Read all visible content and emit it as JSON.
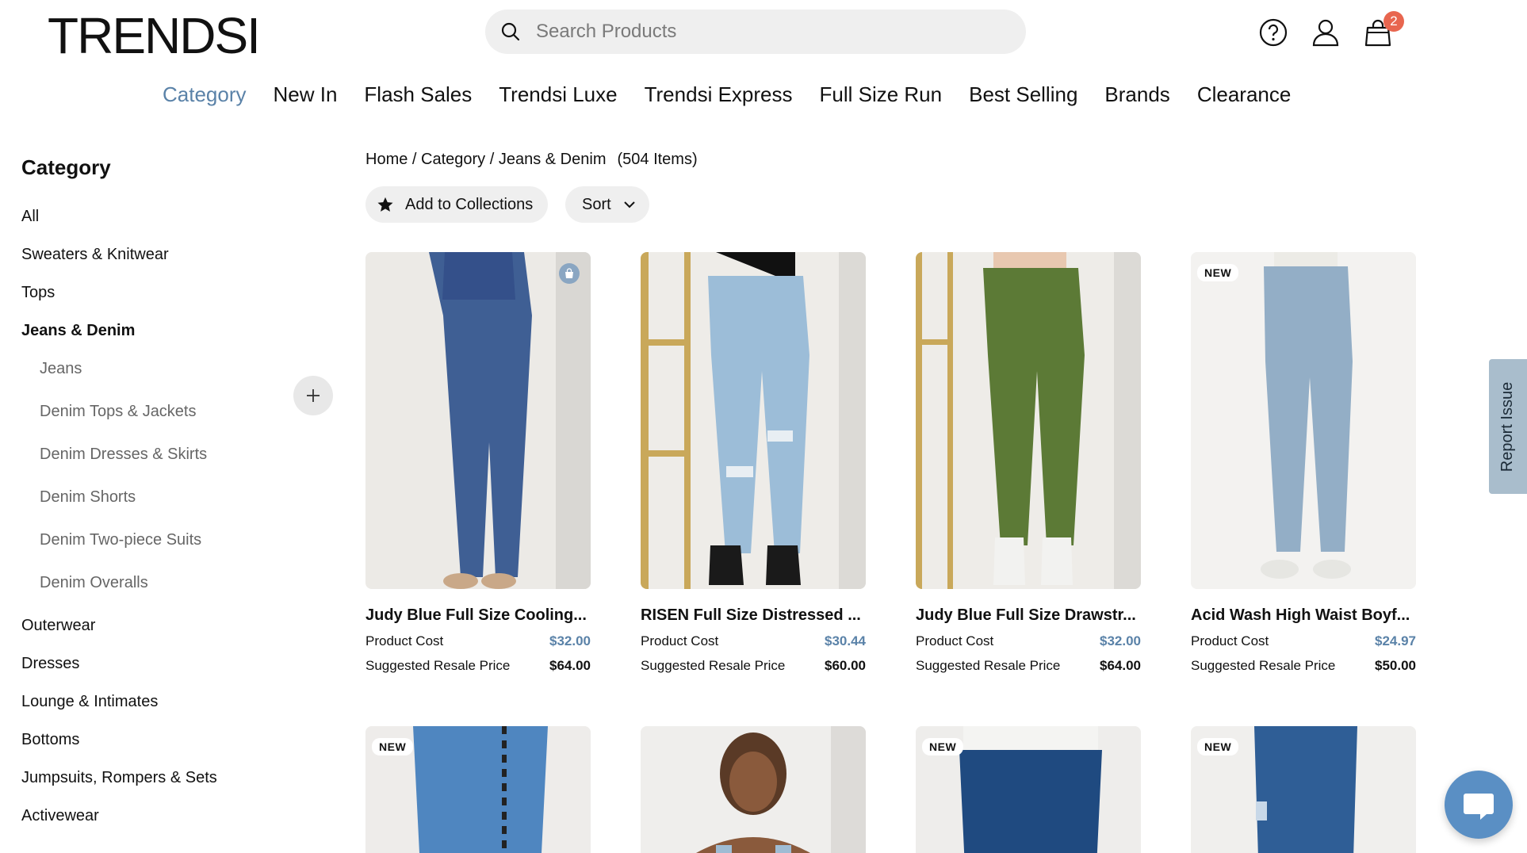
{
  "header": {
    "logo": "TRENDSI",
    "search_placeholder": "Search Products",
    "cart_count": "2"
  },
  "nav": {
    "items": [
      "Category",
      "New In",
      "Flash Sales",
      "Trendsi Luxe",
      "Trendsi Express",
      "Full Size Run",
      "Best Selling",
      "Brands",
      "Clearance"
    ],
    "active": "Category"
  },
  "sidebar": {
    "title": "Category",
    "items_top": [
      "All",
      "Sweaters & Knitwear",
      "Tops"
    ],
    "active_item": "Jeans & Denim",
    "subitems": [
      "Jeans",
      "Denim Tops & Jackets",
      "Denim Dresses & Skirts",
      "Denim Shorts",
      "Denim Two-piece Suits",
      "Denim Overalls"
    ],
    "items_bottom": [
      "Outerwear",
      "Dresses",
      "Lounge & Intimates",
      "Bottoms",
      "Jumpsuits, Rompers & Sets",
      "Activewear"
    ]
  },
  "breadcrumb": {
    "home": "Home",
    "category": "Category",
    "current": "Jeans & Denim",
    "count": "(504 Items)",
    "sep": " / "
  },
  "toolbar": {
    "collections_label": "Add to Collections",
    "sort_label": "Sort"
  },
  "product_labels": {
    "cost": "Product Cost",
    "resale": "Suggested Resale Price",
    "new": "NEW"
  },
  "products": [
    {
      "name": "Judy Blue Full Size Cooling...",
      "cost": "$32.00",
      "resale": "$64.00",
      "is_new": false
    },
    {
      "name": "RISEN Full Size Distressed ...",
      "cost": "$30.44",
      "resale": "$60.00",
      "is_new": false
    },
    {
      "name": "Judy Blue Full Size Drawstr...",
      "cost": "$32.00",
      "resale": "$64.00",
      "is_new": false
    },
    {
      "name": "Acid Wash High Waist Boyf...",
      "cost": "$24.97",
      "resale": "$50.00",
      "is_new": true
    }
  ],
  "products_row2": [
    {
      "is_new": true
    },
    {
      "is_new": false
    },
    {
      "is_new": true
    },
    {
      "is_new": true
    }
  ],
  "report_issue": "Report Issue",
  "colors": {
    "accent": "#5a82a8",
    "badge": "#e8664f"
  }
}
